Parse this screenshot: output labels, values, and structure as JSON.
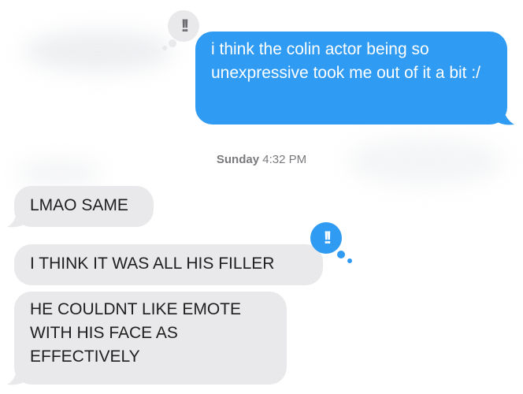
{
  "conversation": {
    "messages": [
      {
        "id": "m1",
        "direction": "sent",
        "text": "i think the colin actor being so unexpressive took me out of it a bit :/"
      },
      {
        "id": "m2",
        "direction": "received",
        "text": "LMAO SAME"
      },
      {
        "id": "m3",
        "direction": "received",
        "text": "I THINK IT WAS ALL HIS FILLER"
      },
      {
        "id": "m4",
        "direction": "received",
        "text": "HE COULDNT LIKE EMOTE WITH HIS FACE AS EFFECTIVELY"
      }
    ],
    "timestamp": {
      "day": "Sunday",
      "time": "4:32 PM"
    },
    "tapbacks": [
      {
        "on": "m1",
        "glyph": "!!",
        "style": "received-reaction"
      },
      {
        "on": "m3",
        "glyph": "!!",
        "style": "own-reaction"
      }
    ]
  },
  "colors": {
    "sent_bubble": "#2f9bf3",
    "received_bubble": "#e9e9eb",
    "timestamp_text": "#7a7a7e"
  },
  "icons": {
    "tapback": "double-exclamation-icon"
  }
}
